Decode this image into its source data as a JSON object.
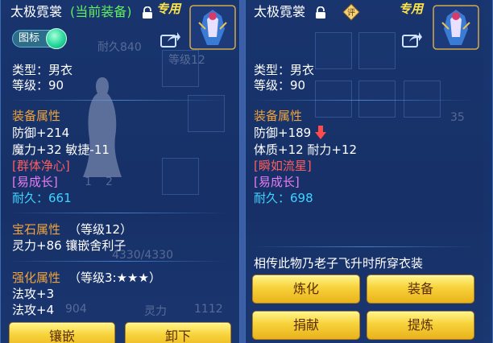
{
  "left": {
    "item_name": "太极霓裳",
    "equip_status": "(当前装备)",
    "exclusive_tag": "专用",
    "icon_toggle_label": "图标",
    "type_line": "类型：男衣",
    "level_line": "等级：90",
    "attr_header": "装备属性",
    "attr_line1": "防御+214",
    "attr_line2": "魔力+32 敏捷-11",
    "skill": "[群体净心]",
    "growth": "[易成长]",
    "durability": "耐久：661",
    "gem_header": "宝石属性",
    "gem_level": "（等级12）",
    "gem_line": "灵力+86 镶嵌舍利子",
    "enhance_header": "强化属性",
    "enhance_level": "（等级3:★★★）",
    "enhance_line1": "法攻+3",
    "enhance_line2": "法攻+4",
    "btn_inlay": "镶嵌",
    "btn_unload": "卸下"
  },
  "right": {
    "item_name": "太极霓裳",
    "exclusive_tag": "专用",
    "type_line": "类型：男衣",
    "level_line": "等级：90",
    "attr_header": "装备属性",
    "attr_line1": "防御+189",
    "attr_line2": "体质+12 耐力+12",
    "skill": "[瞬如流星]",
    "growth": "[易成长]",
    "durability": "耐久：698",
    "lore": "相传此物乃老子飞升时所穿衣装",
    "btn_refine": "炼化",
    "btn_equip": "装备",
    "btn_donate": "捐献",
    "btn_extract": "提炼"
  },
  "background": {
    "ghost_1": "耐久840",
    "ghost_2": "等级12",
    "ghost_3": "4330/4330",
    "ghost_4": "904",
    "ghost_5": "灵力",
    "ghost_6": "1112",
    "ghost_7": "35",
    "ghost_8": "1",
    "ghost_9": "2"
  },
  "colors": {
    "panel_bg": "#18346e",
    "section_header": "#f0a43b",
    "skill_red": "#ff5d5d",
    "growth_magenta": "#e87cf0",
    "durability_cyan": "#3fd4ff",
    "equipped_green": "#5ff05f",
    "button_gold": "#f7d23a"
  },
  "icons": [
    "lock-icon",
    "share-icon",
    "appraise-icon",
    "decrease-arrow-icon",
    "item-portrait-icon"
  ]
}
